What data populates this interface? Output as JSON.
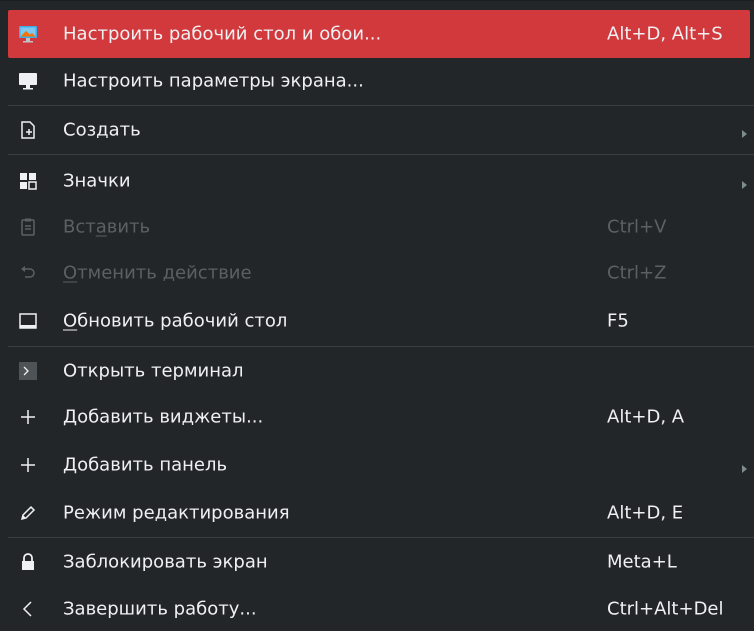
{
  "menu": {
    "items": [
      {
        "label": "Настроить рабочий стол и обои...",
        "shortcut": "Alt+D, Alt+S",
        "icon": "desktop-wallpaper-icon"
      },
      {
        "label": "Настроить параметры экрана...",
        "shortcut": "",
        "icon": "monitor-icon"
      },
      {
        "label": "Создать",
        "shortcut": "",
        "icon": "new-document-icon",
        "submenu": true
      },
      {
        "label": "Значки",
        "shortcut": "",
        "icon": "icons-grid-icon",
        "submenu": true
      },
      {
        "label_pre": "Вст",
        "label_ul": "а",
        "label_post": "вить",
        "shortcut": "Ctrl+V",
        "icon": "clipboard-paste-icon",
        "disabled": true
      },
      {
        "label_pre": "",
        "label_ul": "О",
        "label_post": "тменить действие",
        "shortcut": "Ctrl+Z",
        "icon": "undo-icon",
        "disabled": true
      },
      {
        "label_pre": "",
        "label_ul": "О",
        "label_post": "бновить рабочий стол",
        "shortcut": "F5",
        "icon": "refresh-desktop-icon"
      },
      {
        "label": "Открыть терминал",
        "shortcut": "",
        "icon": "terminal-icon"
      },
      {
        "label": "Добавить виджеты...",
        "shortcut": "Alt+D, A",
        "icon": "plus-icon"
      },
      {
        "label": "Добавить панель",
        "shortcut": "",
        "icon": "plus-icon",
        "submenu": true
      },
      {
        "label": "Режим редактирования",
        "shortcut": "Alt+D, E",
        "icon": "pencil-icon"
      },
      {
        "label": "Заблокировать экран",
        "shortcut": "Meta+L",
        "icon": "lock-icon"
      },
      {
        "label": "Завершить работу...",
        "shortcut": "Ctrl+Alt+Del",
        "icon": "chevron-left-icon"
      }
    ]
  },
  "colors": {
    "background": "#232629",
    "highlight": "#d2393d",
    "text": "#eff0f1",
    "disabled_text": "#5b6064",
    "separator": "#3a3f44"
  }
}
